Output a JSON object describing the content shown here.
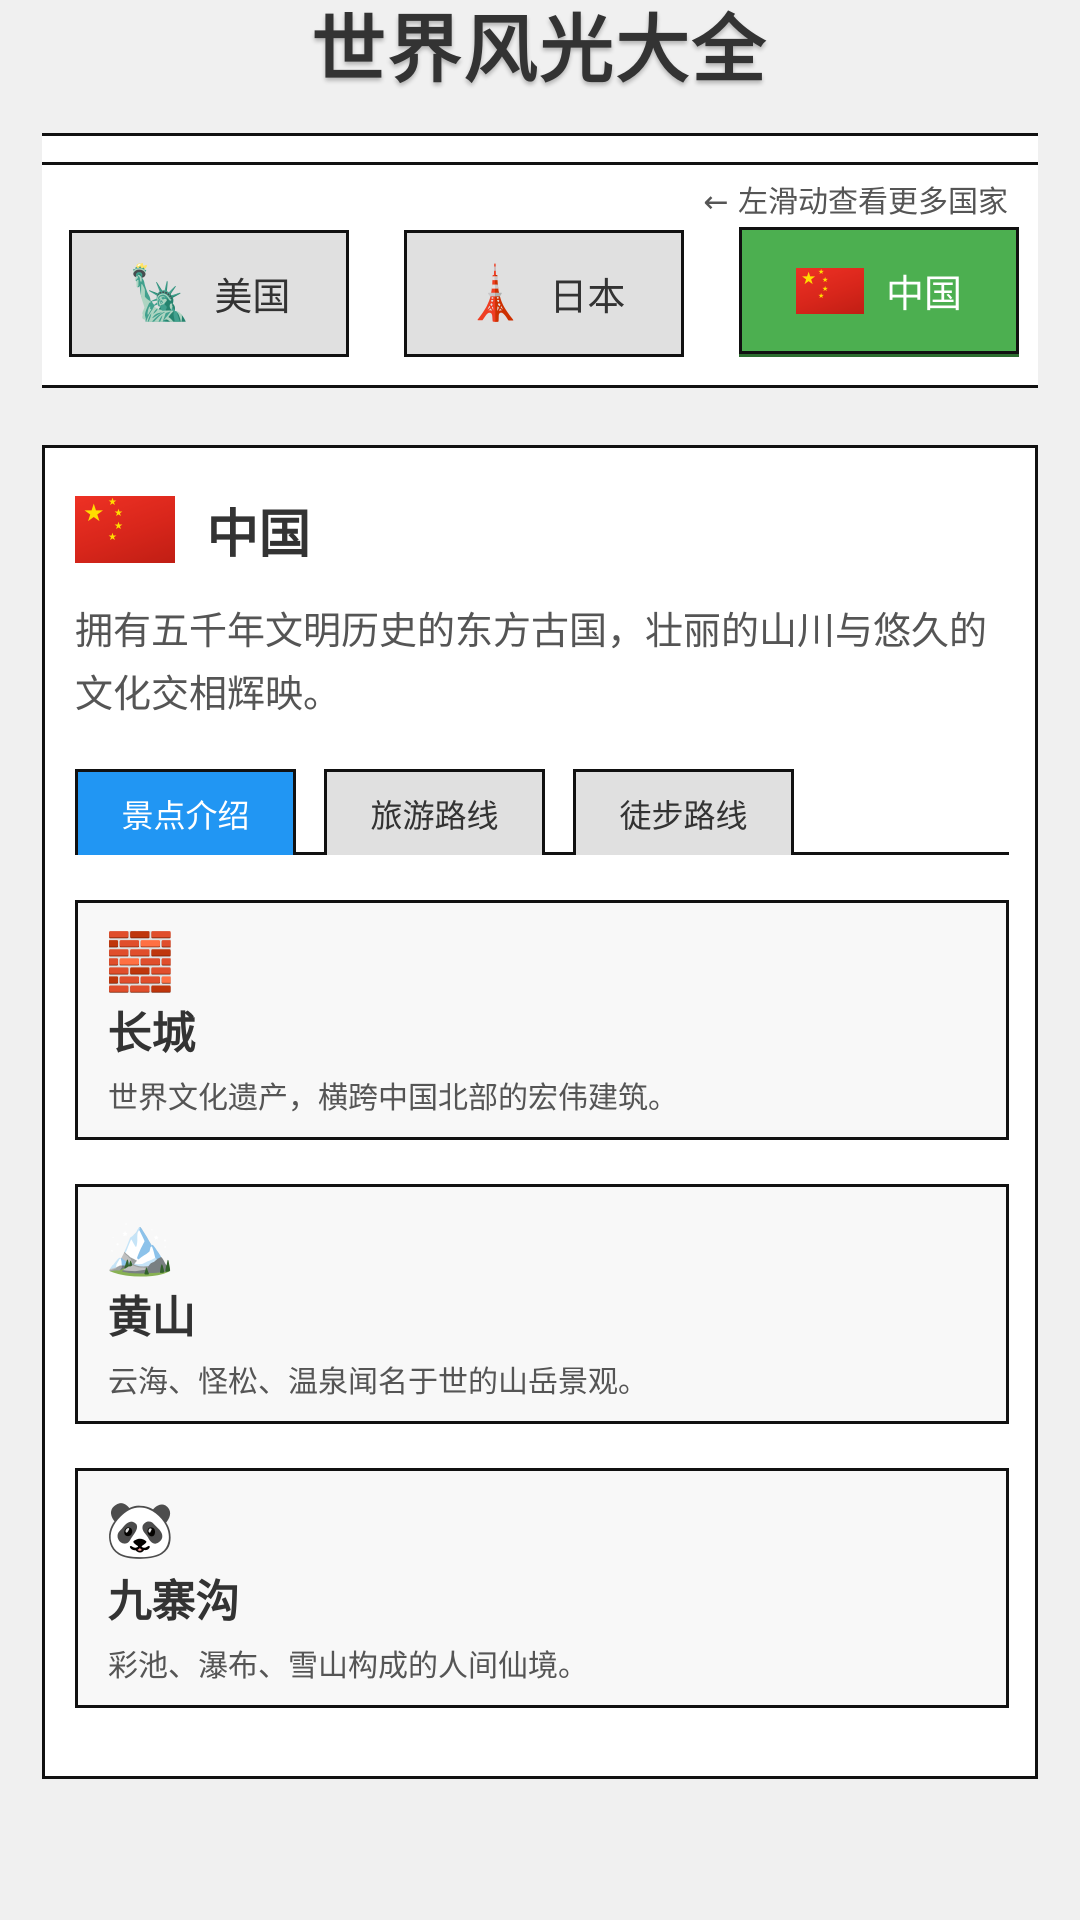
{
  "page": {
    "title": "世界风光大全"
  },
  "country_bar": {
    "swipe_hint": "← 左滑动查看更多国家",
    "countries": [
      {
        "name": "美国",
        "icon": "statue-of-liberty-icon",
        "glyph": "🗽",
        "active": false
      },
      {
        "name": "日本",
        "icon": "tokyo-tower-icon",
        "glyph": "🗼",
        "active": false
      },
      {
        "name": "中国",
        "icon": "china-flag-icon",
        "active": true
      }
    ]
  },
  "selected_country": {
    "name": "中国",
    "flag_icon": "china-flag-icon",
    "description": "拥有五千年文明历史的东方古国，壮丽的山川与悠久的文化交相辉映。"
  },
  "tabs": [
    {
      "label": "景点介绍",
      "active": true
    },
    {
      "label": "旅游路线",
      "active": false
    },
    {
      "label": "徒步路线",
      "active": false
    }
  ],
  "spots": [
    {
      "icon": "brick-icon",
      "glyph": "🧱",
      "title": "长城",
      "description": "世界文化遗产，横跨中国北部的宏伟建筑。"
    },
    {
      "icon": "mountain-icon",
      "glyph": "🏔️",
      "title": "黄山",
      "description": "云海、怪松、温泉闻名于世的山岳景观。"
    },
    {
      "icon": "panda-icon",
      "glyph": "🐼",
      "title": "九寨沟",
      "description": "彩池、瀑布、雪山构成的人间仙境。"
    }
  ],
  "colors": {
    "background": "#f0f0f0",
    "active_country": "#4caf50",
    "active_tab": "#2196f3",
    "inactive_button": "#e0e0e0",
    "card_background": "#f8f8f8",
    "border": "#111111",
    "flag_red": "#de2910",
    "flag_yellow": "#ffde00"
  }
}
